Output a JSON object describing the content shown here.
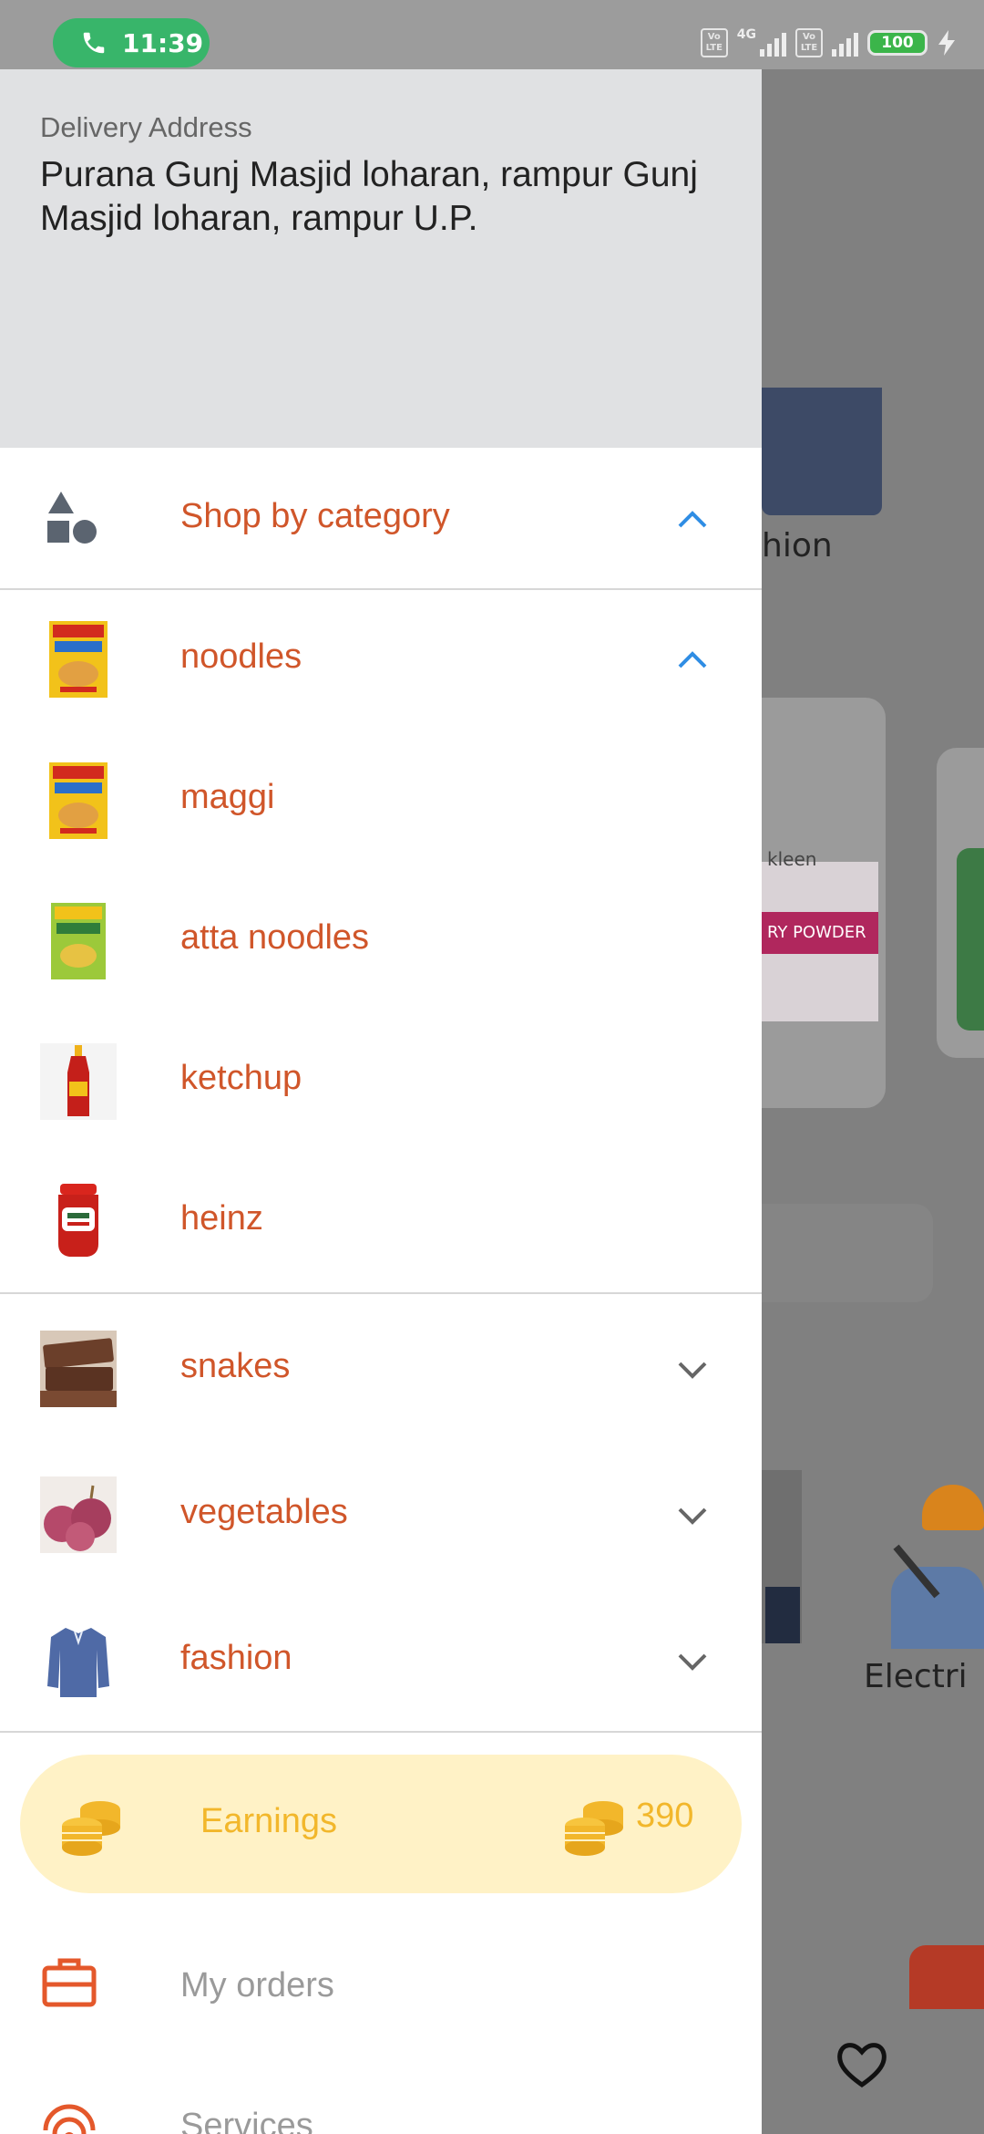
{
  "status_bar": {
    "time": "11:39",
    "battery": "100",
    "network": "4G",
    "volte1": "Vo LTE",
    "volte2": "Vo LTE"
  },
  "drawer": {
    "address_label": "Delivery Address",
    "address_text": "Purana Gunj Masjid loharan, rampur Gunj Masjid loharan, rampur U.P.",
    "shop_by_category": "Shop by category",
    "categories": [
      {
        "label": "noodles",
        "expanded": true,
        "thumb": "noodles-pack-icon"
      },
      {
        "label": "snakes",
        "expanded": false,
        "thumb": "chocolate-bars-icon"
      },
      {
        "label": "vegetables",
        "expanded": false,
        "thumb": "onions-icon"
      },
      {
        "label": "fashion",
        "expanded": false,
        "thumb": "shirt-icon"
      }
    ],
    "subcategories": [
      {
        "label": "maggi",
        "thumb": "noodles-pack-icon"
      },
      {
        "label": "atta noodles",
        "thumb": "atta-noodles-pack-icon"
      },
      {
        "label": "ketchup",
        "thumb": "ketchup-bottle-icon"
      },
      {
        "label": "heinz",
        "thumb": "heinz-bottle-icon"
      }
    ],
    "earnings": {
      "label": "Earnings",
      "value": "390"
    },
    "menu": [
      {
        "label": "My orders",
        "icon": "briefcase-icon"
      },
      {
        "label": "Services",
        "icon": "broadcast-icon"
      }
    ]
  },
  "background": {
    "partial_labels": [
      "hion",
      "Electri"
    ],
    "pack_text": "kleen",
    "pack_band_text": "RY POWDER"
  },
  "colors": {
    "accent_orange": "#d0562a",
    "chevron_blue": "#2f8de4",
    "earnings_yellow": "#f2b72b",
    "earnings_bg": "#fff2c6",
    "call_green": "#38b56a"
  }
}
